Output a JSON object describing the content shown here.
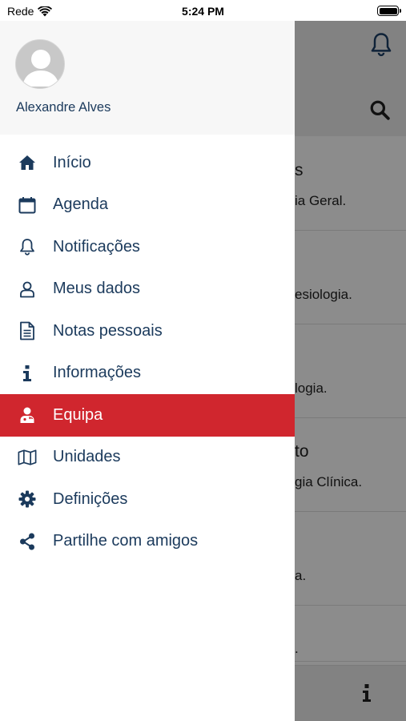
{
  "status_bar": {
    "carrier": "Rede",
    "time": "5:24 PM"
  },
  "profile": {
    "name": "Alexandre Alves"
  },
  "menu": {
    "items": [
      {
        "label": "Início",
        "icon": "home-icon"
      },
      {
        "label": "Agenda",
        "icon": "calendar-icon"
      },
      {
        "label": "Notificações",
        "icon": "bell-icon"
      },
      {
        "label": "Meus dados",
        "icon": "user-icon"
      },
      {
        "label": "Notas pessoais",
        "icon": "document-icon"
      },
      {
        "label": "Informações",
        "icon": "info-icon"
      },
      {
        "label": "Equipa",
        "icon": "doctor-icon",
        "active": true
      },
      {
        "label": "Unidades",
        "icon": "map-icon"
      },
      {
        "label": "Definições",
        "icon": "gear-icon"
      },
      {
        "label": "Partilhe com amigos",
        "icon": "share-icon"
      }
    ]
  },
  "background_list": {
    "items": [
      {
        "line1": "s",
        "line2": "ia Geral."
      },
      {
        "line1": "",
        "line2": "esiologia."
      },
      {
        "line1": "",
        "line2": "logia."
      },
      {
        "line1": "to",
        "line2": "gia Clínica."
      },
      {
        "line1": "",
        "line2": "a."
      },
      {
        "line1": "",
        "line2": "."
      }
    ]
  },
  "colors": {
    "primary": "#1b3a5c",
    "active": "#d0262e",
    "overlay": "#8c8c8c"
  }
}
